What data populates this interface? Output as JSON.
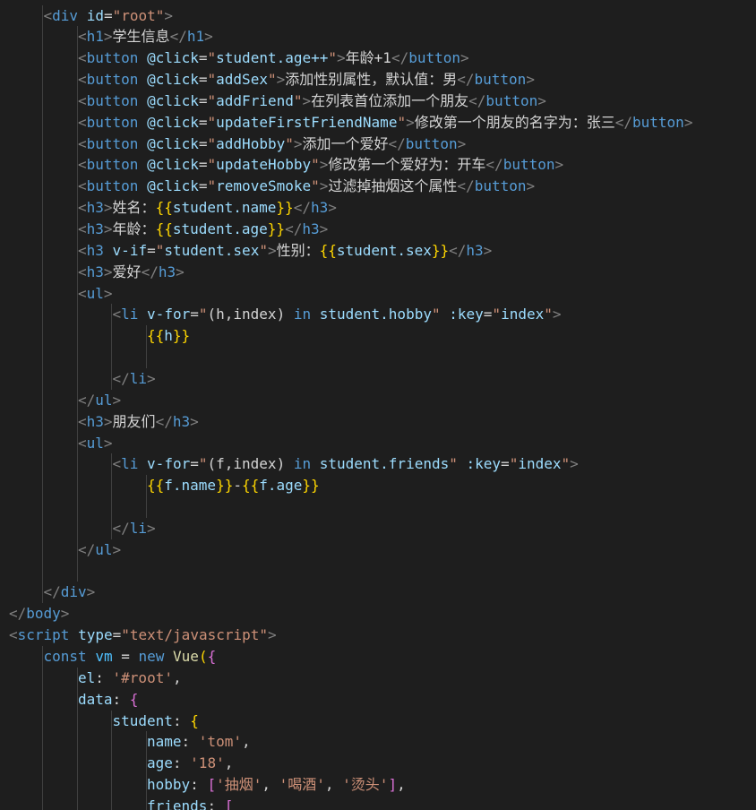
{
  "editor": {
    "language": "html",
    "theme_background": "#1e1e1e",
    "lines": [
      {
        "indent": 1,
        "tokens": [
          [
            "punc",
            "<"
          ],
          [
            "tag",
            "div"
          ],
          [
            "text",
            " "
          ],
          [
            "attr",
            "id"
          ],
          [
            "text",
            "="
          ],
          [
            "str",
            "\"root\""
          ],
          [
            "punc",
            ">"
          ]
        ]
      },
      {
        "indent": 2,
        "tokens": [
          [
            "punc",
            "<"
          ],
          [
            "tag",
            "h1"
          ],
          [
            "punc",
            ">"
          ],
          [
            "text",
            "学生信息"
          ],
          [
            "punc",
            "</"
          ],
          [
            "tag",
            "h1"
          ],
          [
            "punc",
            ">"
          ]
        ]
      },
      {
        "indent": 2,
        "tokens": [
          [
            "punc",
            "<"
          ],
          [
            "tag",
            "button"
          ],
          [
            "text",
            " "
          ],
          [
            "attr",
            "@click"
          ],
          [
            "text",
            "="
          ],
          [
            "str",
            "\""
          ],
          [
            "var",
            "student.age++"
          ],
          [
            "str",
            "\""
          ],
          [
            "punc",
            ">"
          ],
          [
            "text",
            "年龄+1"
          ],
          [
            "punc",
            "</"
          ],
          [
            "tag",
            "button"
          ],
          [
            "punc",
            ">"
          ]
        ]
      },
      {
        "indent": 2,
        "tokens": [
          [
            "punc",
            "<"
          ],
          [
            "tag",
            "button"
          ],
          [
            "text",
            " "
          ],
          [
            "attr",
            "@click"
          ],
          [
            "text",
            "="
          ],
          [
            "str",
            "\""
          ],
          [
            "var",
            "addSex"
          ],
          [
            "str",
            "\""
          ],
          [
            "punc",
            ">"
          ],
          [
            "text",
            "添加性别属性，默认值：男"
          ],
          [
            "punc",
            "</"
          ],
          [
            "tag",
            "button"
          ],
          [
            "punc",
            ">"
          ]
        ]
      },
      {
        "indent": 2,
        "tokens": [
          [
            "punc",
            "<"
          ],
          [
            "tag",
            "button"
          ],
          [
            "text",
            " "
          ],
          [
            "attr",
            "@click"
          ],
          [
            "text",
            "="
          ],
          [
            "str",
            "\""
          ],
          [
            "var",
            "addFriend"
          ],
          [
            "str",
            "\""
          ],
          [
            "punc",
            ">"
          ],
          [
            "text",
            "在列表首位添加一个朋友"
          ],
          [
            "punc",
            "</"
          ],
          [
            "tag",
            "button"
          ],
          [
            "punc",
            ">"
          ]
        ]
      },
      {
        "indent": 2,
        "tokens": [
          [
            "punc",
            "<"
          ],
          [
            "tag",
            "button"
          ],
          [
            "text",
            " "
          ],
          [
            "attr",
            "@click"
          ],
          [
            "text",
            "="
          ],
          [
            "str",
            "\""
          ],
          [
            "var",
            "updateFirstFriendName"
          ],
          [
            "str",
            "\""
          ],
          [
            "punc",
            ">"
          ],
          [
            "text",
            "修改第一个朋友的名字为：张三"
          ],
          [
            "punc",
            "</"
          ],
          [
            "tag",
            "button"
          ],
          [
            "punc",
            ">"
          ]
        ]
      },
      {
        "indent": 2,
        "tokens": [
          [
            "punc",
            "<"
          ],
          [
            "tag",
            "button"
          ],
          [
            "text",
            " "
          ],
          [
            "attr",
            "@click"
          ],
          [
            "text",
            "="
          ],
          [
            "str",
            "\""
          ],
          [
            "var",
            "addHobby"
          ],
          [
            "str",
            "\""
          ],
          [
            "punc",
            ">"
          ],
          [
            "text",
            "添加一个爱好"
          ],
          [
            "punc",
            "</"
          ],
          [
            "tag",
            "button"
          ],
          [
            "punc",
            ">"
          ]
        ]
      },
      {
        "indent": 2,
        "tokens": [
          [
            "punc",
            "<"
          ],
          [
            "tag",
            "button"
          ],
          [
            "text",
            " "
          ],
          [
            "attr",
            "@click"
          ],
          [
            "text",
            "="
          ],
          [
            "str",
            "\""
          ],
          [
            "var",
            "updateHobby"
          ],
          [
            "str",
            "\""
          ],
          [
            "punc",
            ">"
          ],
          [
            "text",
            "修改第一个爱好为：开车"
          ],
          [
            "punc",
            "</"
          ],
          [
            "tag",
            "button"
          ],
          [
            "punc",
            ">"
          ]
        ]
      },
      {
        "indent": 2,
        "tokens": [
          [
            "punc",
            "<"
          ],
          [
            "tag",
            "button"
          ],
          [
            "text",
            " "
          ],
          [
            "attr",
            "@click"
          ],
          [
            "text",
            "="
          ],
          [
            "str",
            "\""
          ],
          [
            "var",
            "removeSmoke"
          ],
          [
            "str",
            "\""
          ],
          [
            "punc",
            ">"
          ],
          [
            "text",
            "过滤掉抽烟这个属性"
          ],
          [
            "punc",
            "</"
          ],
          [
            "tag",
            "button"
          ],
          [
            "punc",
            ">"
          ]
        ]
      },
      {
        "indent": 2,
        "tokens": [
          [
            "punc",
            "<"
          ],
          [
            "tag",
            "h3"
          ],
          [
            "punc",
            ">"
          ],
          [
            "text",
            "姓名："
          ],
          [
            "brace",
            "{{"
          ],
          [
            "var",
            "student.name"
          ],
          [
            "brace",
            "}}"
          ],
          [
            "punc",
            "</"
          ],
          [
            "tag",
            "h3"
          ],
          [
            "punc",
            ">"
          ]
        ]
      },
      {
        "indent": 2,
        "tokens": [
          [
            "punc",
            "<"
          ],
          [
            "tag",
            "h3"
          ],
          [
            "punc",
            ">"
          ],
          [
            "text",
            "年龄："
          ],
          [
            "brace",
            "{{"
          ],
          [
            "var",
            "student.age"
          ],
          [
            "brace",
            "}}"
          ],
          [
            "punc",
            "</"
          ],
          [
            "tag",
            "h3"
          ],
          [
            "punc",
            ">"
          ]
        ]
      },
      {
        "indent": 2,
        "tokens": [
          [
            "punc",
            "<"
          ],
          [
            "tag",
            "h3"
          ],
          [
            "text",
            " "
          ],
          [
            "attr",
            "v-if"
          ],
          [
            "text",
            "="
          ],
          [
            "str",
            "\""
          ],
          [
            "var",
            "student.sex"
          ],
          [
            "str",
            "\""
          ],
          [
            "punc",
            ">"
          ],
          [
            "text",
            "性别："
          ],
          [
            "brace",
            "{{"
          ],
          [
            "var",
            "student.sex"
          ],
          [
            "brace",
            "}}"
          ],
          [
            "punc",
            "</"
          ],
          [
            "tag",
            "h3"
          ],
          [
            "punc",
            ">"
          ]
        ]
      },
      {
        "indent": 2,
        "tokens": [
          [
            "punc",
            "<"
          ],
          [
            "tag",
            "h3"
          ],
          [
            "punc",
            ">"
          ],
          [
            "text",
            "爱好"
          ],
          [
            "punc",
            "</"
          ],
          [
            "tag",
            "h3"
          ],
          [
            "punc",
            ">"
          ]
        ]
      },
      {
        "indent": 2,
        "tokens": [
          [
            "punc",
            "<"
          ],
          [
            "tag",
            "ul"
          ],
          [
            "punc",
            ">"
          ]
        ]
      },
      {
        "indent": 3,
        "tokens": [
          [
            "punc",
            "<"
          ],
          [
            "tag",
            "li"
          ],
          [
            "text",
            " "
          ],
          [
            "attr",
            "v-for"
          ],
          [
            "text",
            "="
          ],
          [
            "str",
            "\""
          ],
          [
            "text",
            "(h,index) "
          ],
          [
            "kw",
            "in"
          ],
          [
            "text",
            " "
          ],
          [
            "var",
            "student.hobby"
          ],
          [
            "str",
            "\""
          ],
          [
            "text",
            " "
          ],
          [
            "attr",
            ":key"
          ],
          [
            "text",
            "="
          ],
          [
            "str",
            "\""
          ],
          [
            "var",
            "index"
          ],
          [
            "str",
            "\""
          ],
          [
            "punc",
            ">"
          ]
        ]
      },
      {
        "indent": 4,
        "tokens": [
          [
            "brace",
            "{{"
          ],
          [
            "var",
            "h"
          ],
          [
            "brace",
            "}}"
          ]
        ]
      },
      {
        "indent": 4,
        "tokens": []
      },
      {
        "indent": 3,
        "tokens": [
          [
            "punc",
            "</"
          ],
          [
            "tag",
            "li"
          ],
          [
            "punc",
            ">"
          ]
        ]
      },
      {
        "indent": 2,
        "tokens": [
          [
            "punc",
            "</"
          ],
          [
            "tag",
            "ul"
          ],
          [
            "punc",
            ">"
          ]
        ]
      },
      {
        "indent": 2,
        "tokens": [
          [
            "punc",
            "<"
          ],
          [
            "tag",
            "h3"
          ],
          [
            "punc",
            ">"
          ],
          [
            "text",
            "朋友们"
          ],
          [
            "punc",
            "</"
          ],
          [
            "tag",
            "h3"
          ],
          [
            "punc",
            ">"
          ]
        ]
      },
      {
        "indent": 2,
        "tokens": [
          [
            "punc",
            "<"
          ],
          [
            "tag",
            "ul"
          ],
          [
            "punc",
            ">"
          ]
        ]
      },
      {
        "indent": 3,
        "tokens": [
          [
            "punc",
            "<"
          ],
          [
            "tag",
            "li"
          ],
          [
            "text",
            " "
          ],
          [
            "attr",
            "v-for"
          ],
          [
            "text",
            "="
          ],
          [
            "str",
            "\""
          ],
          [
            "text",
            "(f,index) "
          ],
          [
            "kw",
            "in"
          ],
          [
            "text",
            " "
          ],
          [
            "var",
            "student.friends"
          ],
          [
            "str",
            "\""
          ],
          [
            "text",
            " "
          ],
          [
            "attr",
            ":key"
          ],
          [
            "text",
            "="
          ],
          [
            "str",
            "\""
          ],
          [
            "var",
            "index"
          ],
          [
            "str",
            "\""
          ],
          [
            "punc",
            ">"
          ]
        ]
      },
      {
        "indent": 4,
        "tokens": [
          [
            "brace",
            "{{"
          ],
          [
            "var",
            "f.name"
          ],
          [
            "brace",
            "}}"
          ],
          [
            "text",
            "-"
          ],
          [
            "brace",
            "{{"
          ],
          [
            "var",
            "f.age"
          ],
          [
            "brace",
            "}}"
          ]
        ]
      },
      {
        "indent": 4,
        "tokens": []
      },
      {
        "indent": 3,
        "tokens": [
          [
            "punc",
            "</"
          ],
          [
            "tag",
            "li"
          ],
          [
            "punc",
            ">"
          ]
        ]
      },
      {
        "indent": 2,
        "tokens": [
          [
            "punc",
            "</"
          ],
          [
            "tag",
            "ul"
          ],
          [
            "punc",
            ">"
          ]
        ]
      },
      {
        "indent": 2,
        "tokens": []
      },
      {
        "indent": 1,
        "tokens": [
          [
            "punc",
            "</"
          ],
          [
            "tag",
            "div"
          ],
          [
            "punc",
            ">"
          ]
        ]
      },
      {
        "indent": 0,
        "tokens": [
          [
            "punc",
            "</"
          ],
          [
            "tag",
            "body"
          ],
          [
            "punc",
            ">"
          ]
        ]
      },
      {
        "indent": 0,
        "tokens": [
          [
            "punc",
            "<"
          ],
          [
            "tag",
            "script"
          ],
          [
            "text",
            " "
          ],
          [
            "attr",
            "type"
          ],
          [
            "text",
            "="
          ],
          [
            "str",
            "\"text/javascript\""
          ],
          [
            "punc",
            ">"
          ]
        ]
      },
      {
        "indent": 1,
        "tokens": [
          [
            "kw",
            "const"
          ],
          [
            "text",
            " "
          ],
          [
            "const",
            "vm"
          ],
          [
            "text",
            " = "
          ],
          [
            "kw",
            "new"
          ],
          [
            "text",
            " "
          ],
          [
            "fn",
            "Vue"
          ],
          [
            "brace",
            "("
          ],
          [
            "brk",
            "{"
          ]
        ]
      },
      {
        "indent": 2,
        "tokens": [
          [
            "var",
            "el"
          ],
          [
            "text",
            ": "
          ],
          [
            "str",
            "'#root'"
          ],
          [
            "text",
            ","
          ]
        ]
      },
      {
        "indent": 2,
        "tokens": [
          [
            "var",
            "data"
          ],
          [
            "text",
            ": "
          ],
          [
            "brk",
            "{"
          ]
        ]
      },
      {
        "indent": 3,
        "tokens": [
          [
            "var",
            "student"
          ],
          [
            "text",
            ": "
          ],
          [
            "brace",
            "{"
          ]
        ]
      },
      {
        "indent": 4,
        "tokens": [
          [
            "var",
            "name"
          ],
          [
            "text",
            ": "
          ],
          [
            "str",
            "'tom'"
          ],
          [
            "text",
            ","
          ]
        ]
      },
      {
        "indent": 4,
        "tokens": [
          [
            "var",
            "age"
          ],
          [
            "text",
            ": "
          ],
          [
            "str",
            "'18'"
          ],
          [
            "text",
            ","
          ]
        ]
      },
      {
        "indent": 4,
        "tokens": [
          [
            "var",
            "hobby"
          ],
          [
            "text",
            ": "
          ],
          [
            "brk",
            "["
          ],
          [
            "str",
            "'抽烟'"
          ],
          [
            "text",
            ", "
          ],
          [
            "str",
            "'喝酒'"
          ],
          [
            "text",
            ", "
          ],
          [
            "str",
            "'烫头'"
          ],
          [
            "brk",
            "]"
          ],
          [
            "text",
            ","
          ]
        ]
      },
      {
        "indent": 4,
        "tokens": [
          [
            "var",
            "friends"
          ],
          [
            "text",
            ": "
          ],
          [
            "brk",
            "["
          ]
        ]
      }
    ]
  }
}
